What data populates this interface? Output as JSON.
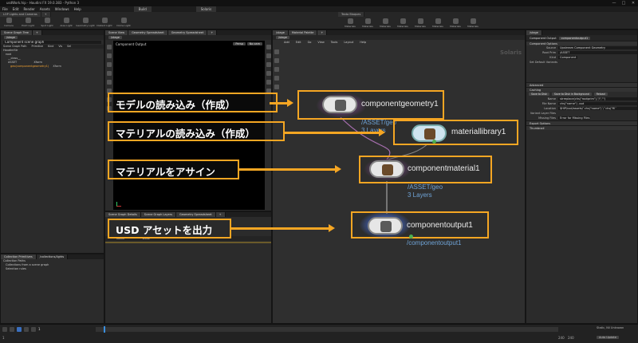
{
  "window": {
    "title": "usdWork.hip - Houdini FX 19.0.383 - Python 3",
    "controls": [
      "—",
      "□",
      "✕"
    ]
  },
  "menu": [
    "File",
    "Edit",
    "Render",
    "Assets",
    "Windows",
    "Help"
  ],
  "desktop_tabs": [
    "Build",
    "Solaris"
  ],
  "shelf_left": {
    "tabs": [
      "LOP Lights and Cameras",
      "+"
    ],
    "items": [
      "Camera",
      "Point Light",
      "Spot Light",
      "Area Light",
      "Geometry Light",
      "Distant Light",
      "Dome Light"
    ]
  },
  "shelf_right": {
    "tabs": [
      "Texto Bloques"
    ],
    "items": [
      "Materials",
      "Materials",
      "Materials",
      "Materials",
      "Materials",
      "Materials",
      "Materials",
      "Materials"
    ]
  },
  "left_panel": {
    "tabs": [
      "Scene Graph Tree",
      "+"
    ],
    "path": "/stage",
    "filter_placeholder": "Component scene graph",
    "columns": [
      "Scene Graph Path",
      "Primitive",
      "Kind",
      "Vis",
      "Sel"
    ],
    "rows": [
      {
        "label": "HoudiniStr",
        "kind": ""
      },
      {
        "label": "root",
        "kind": ""
      },
      {
        "label": "__class__",
        "kind": ""
      },
      {
        "label": "ASSET",
        "kind": "Xform"
      },
      {
        "label": "geo(componentgeometry1)",
        "kind": "Xform"
      }
    ],
    "bottom_tabs": [
      "Collection Primitives",
      "/collections/lights"
    ],
    "bottom_rows": [
      "Collection Paths",
      "Collections from a scene graph",
      "Selection rules"
    ]
  },
  "viewer": {
    "tabs": [
      "Scene View",
      "Geometry Spreadsheet",
      "Geometry Spreadsheet",
      "+"
    ],
    "title": "Component Output",
    "persp": "Persp",
    "cam": "No cam",
    "path": "/stage"
  },
  "bottom_mid": {
    "tabs": [
      "Scene Graph Details",
      "Scene Graph Layers",
      "Geometry Spreadsheet",
      "+"
    ],
    "columns": [
      "Name",
      "Value"
    ]
  },
  "network": {
    "tabs": [
      "/stage",
      "Material Palette",
      "+"
    ],
    "path": "/stage",
    "menu": [
      "Add",
      "Edit",
      "Go",
      "View",
      "Tools",
      "Layout",
      "Help"
    ],
    "context": "Solaris",
    "nodes": {
      "geometry": {
        "name": "componentgeometry1",
        "sub1": "/ASSET/geo",
        "sub2": "3 Layers"
      },
      "material_library": {
        "name": "materiallibrary1"
      },
      "material": {
        "name": "componentmaterial1",
        "sub1": "/ASSET/geo",
        "sub2": "3 Layers"
      },
      "output": {
        "name": "componentoutput1",
        "sub1": "/componentoutput1"
      }
    }
  },
  "annotations": {
    "a1": "モデルの読み込み（作成）",
    "a2": "マテリアルの読み込み（作成）",
    "a3": "マテリアルをアサイン",
    "a4": "USD アセットを出力"
  },
  "parameters": {
    "tabs": [
      "Component Output",
      "componentoutput1"
    ],
    "sections": [
      "Component Options",
      "Advanced",
      "Caching",
      "Export Options",
      "Thumbnail"
    ],
    "rows": [
      {
        "label": "Source",
        "value": "Upstream Component Geometry"
      },
      {
        "label": "Root Prim",
        "value": "/ASSET"
      },
      {
        "label": "Kind",
        "value": "Component"
      },
      {
        "label": "Set Default Variants",
        "value": ""
      }
    ],
    "buttons": [
      "Save to Disk",
      "Save to Disk in Background",
      "Reload"
    ],
    "cache_rows": [
      {
        "label": "Name",
        "value": "strreplace(chs(\"rootprim\"),\"/\",\"\")"
      },
      {
        "label": "File Name",
        "value": "chs(\"name\") .usd"
      },
      {
        "label": "Location",
        "value": "$HIP/usd/assets/`chs(\"name\")`/`chs(\"fil`"
      },
      {
        "label": "Variant Layer Files",
        "value": ""
      },
      {
        "label": "Missing Files",
        "value": "Error for Missing Files"
      }
    ]
  },
  "timeline": {
    "frame": "1",
    "start": "1",
    "end": "240",
    "end2": "240",
    "range_label": "Static, Nil Unknown",
    "auto_update": "Auto Update"
  },
  "colors": {
    "accent": "#f5a623",
    "link": "#6fa3d6",
    "bg": "#2a2a2a"
  }
}
